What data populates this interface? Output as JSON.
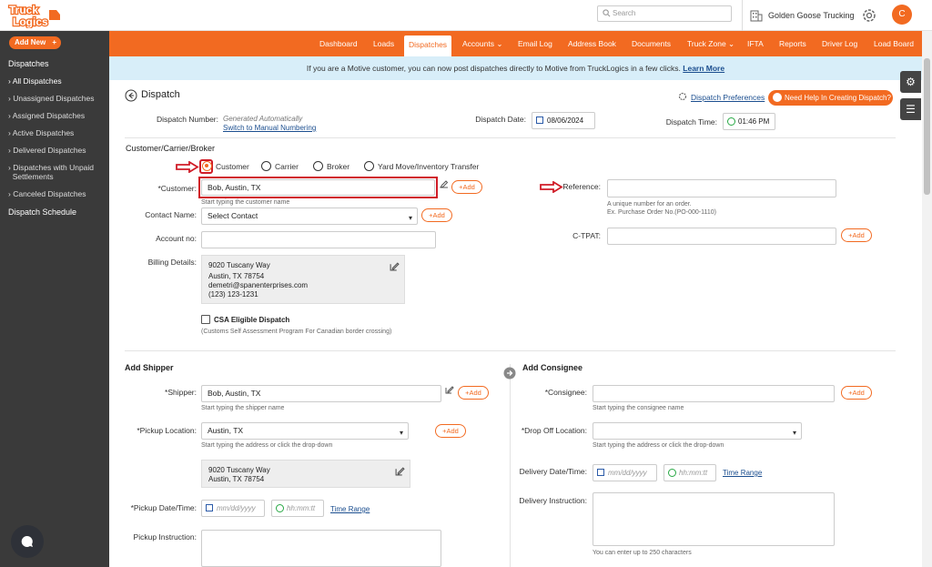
{
  "header": {
    "search_placeholder": "Search",
    "company": "Golden Goose Trucking",
    "avatar_initial": "C"
  },
  "sidebar": {
    "add_new": "Add New",
    "section": "Dispatches",
    "items": [
      "All Dispatches",
      "Unassigned Dispatches",
      "Assigned Dispatches",
      "Active Dispatches",
      "Delivered Dispatches",
      "Dispatches with Unpaid",
      "Settlements",
      "Canceled Dispatches"
    ],
    "schedule": "Dispatch Schedule"
  },
  "nav": {
    "items": [
      "Dashboard",
      "Loads",
      "Dispatches",
      "Accounts ⌄",
      "Email Log",
      "Address Book",
      "Documents",
      "Truck Zone ⌄",
      "IFTA",
      "Reports",
      "Driver Log",
      "Load Board"
    ]
  },
  "banner": {
    "text": "If you are a Motive customer, you can now post dispatches directly to Motive from TruckLogics in a few clicks.",
    "link": "Learn More"
  },
  "page": {
    "title": "Dispatch",
    "preferences": "Dispatch Preferences",
    "help": "Need Help In Creating Dispatch?"
  },
  "dispatch": {
    "number_label": "Dispatch Number:",
    "number_value": "Generated Automatically",
    "switch_link": "Switch to Manual Numbering",
    "date_label": "Dispatch Date:",
    "date_value": "08/06/2024",
    "time_label": "Dispatch Time:",
    "time_value": "01:46 PM"
  },
  "ccb": {
    "title": "Customer/Carrier/Broker",
    "options": [
      "Customer",
      "Carrier",
      "Broker",
      "Yard Move/Inventory Transfer"
    ],
    "selected": "Customer",
    "customer_label": "*Customer:",
    "customer_value": "Bob, Austin, TX",
    "customer_hint": "Start typing the customer name",
    "add": "+Add",
    "reference_label": "Reference:",
    "reference_hint1": "A unique number for an order.",
    "reference_hint2": "Ex. Purchase Order No.(PO-000-1110)",
    "contact_label": "Contact Name:",
    "contact_value": "Select Contact",
    "account_label": "Account no:",
    "ctpat_label": "C-TPAT:",
    "billing_label": "Billing Details:",
    "billing_lines": [
      "9020 Tuscany Way",
      "Austin, TX 78754",
      "demetri@spanenterprises.com",
      "(123) 123-1231"
    ],
    "csa_label": "CSA Eligible Dispatch",
    "csa_hint": "(Customs Self Assessment Program For Canadian border crossing)"
  },
  "shipper": {
    "title": "Add Shipper",
    "shipper_label": "*Shipper:",
    "shipper_value": "Bob, Austin, TX",
    "shipper_hint": "Start typing the shipper name",
    "pickup_loc_label": "*Pickup Location:",
    "pickup_loc_value": "Austin, TX",
    "pickup_loc_hint": "Start typing the address or click the drop-down",
    "address_lines": [
      "9020 Tuscany Way",
      "Austin, TX 78754"
    ],
    "pickup_dt_label": "*Pickup Date/Time:",
    "date_ph": "mm/dd/yyyy",
    "time_ph": "hh:mm:tt",
    "time_range": "Time Range",
    "pickup_instr_label": "Pickup Instruction:"
  },
  "consignee": {
    "title": "Add Consignee",
    "consignee_label": "*Consignee:",
    "consignee_hint": "Start typing the consignee name",
    "drop_label": "*Drop Off Location:",
    "drop_hint": "Start typing the address or click the drop-down",
    "delivery_dt_label": "Delivery Date/Time:",
    "date_ph": "mm/dd/yyyy",
    "time_ph": "hh:mm:tt",
    "time_range": "Time Range",
    "delivery_instr_label": "Delivery Instruction:",
    "delivery_hint": "You can enter up to 250 characters"
  },
  "colors": {
    "brand": "#f26a21",
    "annotation": "#d01c27"
  }
}
